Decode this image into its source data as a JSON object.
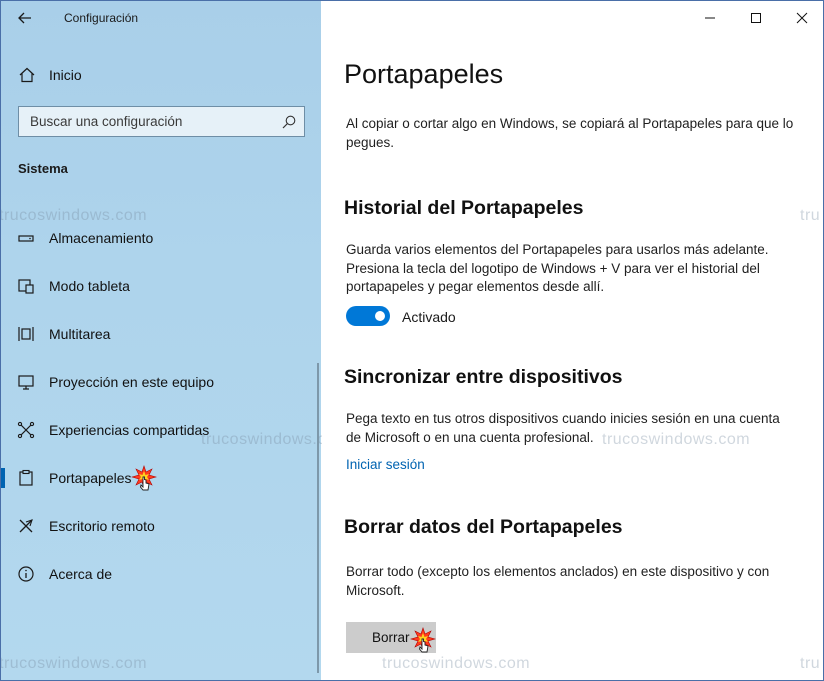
{
  "window": {
    "title": "Configuración"
  },
  "sidebar": {
    "home_label": "Inicio",
    "search_placeholder": "Buscar una configuración",
    "section_title": "Sistema",
    "items": [
      {
        "label": "Almacenamiento",
        "icon": "storage-icon"
      },
      {
        "label": "Modo tableta",
        "icon": "tablet-mode-icon"
      },
      {
        "label": "Multitarea",
        "icon": "multitasking-icon"
      },
      {
        "label": "Proyección en este equipo",
        "icon": "projecting-icon"
      },
      {
        "label": "Experiencias compartidas",
        "icon": "shared-experiences-icon"
      },
      {
        "label": "Portapapeles",
        "icon": "clipboard-icon",
        "active": true
      },
      {
        "label": "Escritorio remoto",
        "icon": "remote-desktop-icon"
      },
      {
        "label": "Acerca de",
        "icon": "info-icon"
      }
    ]
  },
  "main": {
    "title": "Portapapeles",
    "intro": "Al copiar o cortar algo en Windows, se copiará al Portapapeles para que lo pegues.",
    "history": {
      "heading": "Historial del Portapapeles",
      "description": "Guarda varios elementos del Portapapeles para usarlos más adelante. Presiona la tecla del logotipo de Windows + V para ver el historial del portapapeles y pegar elementos desde allí.",
      "toggle_state": "Activado",
      "toggle_on": true
    },
    "sync": {
      "heading": "Sincronizar entre dispositivos",
      "description": "Pega texto en tus otros dispositivos cuando inicies sesión en una cuenta de Microsoft o en una cuenta profesional.",
      "link": "Iniciar sesión"
    },
    "clear": {
      "heading": "Borrar datos del Portapapeles",
      "description": "Borrar todo (excepto los elementos anclados) en este dispositivo y con Microsoft.",
      "button": "Borrar"
    }
  },
  "watermark": "trucoswindows.com",
  "colors": {
    "accent": "#0078d7",
    "link": "#0063b1",
    "sidebar_bg": "#aed4ec",
    "button_bg": "#cccccc"
  }
}
